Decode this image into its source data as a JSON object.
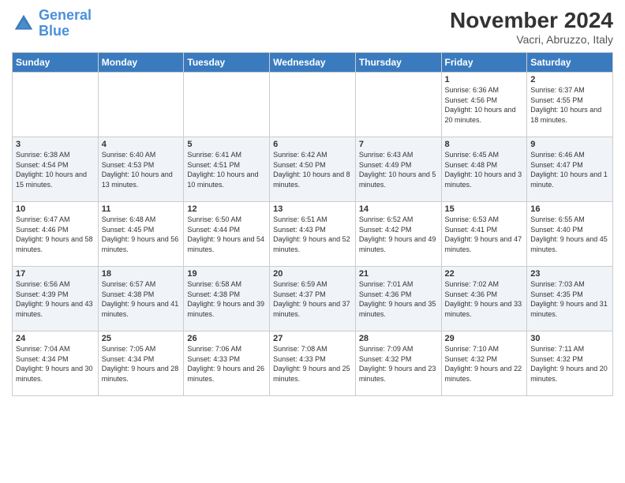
{
  "header": {
    "logo_line1": "General",
    "logo_line2": "Blue",
    "month": "November 2024",
    "location": "Vacri, Abruzzo, Italy"
  },
  "weekdays": [
    "Sunday",
    "Monday",
    "Tuesday",
    "Wednesday",
    "Thursday",
    "Friday",
    "Saturday"
  ],
  "weeks": [
    [
      {
        "day": "",
        "info": ""
      },
      {
        "day": "",
        "info": ""
      },
      {
        "day": "",
        "info": ""
      },
      {
        "day": "",
        "info": ""
      },
      {
        "day": "",
        "info": ""
      },
      {
        "day": "1",
        "info": "Sunrise: 6:36 AM\nSunset: 4:56 PM\nDaylight: 10 hours and 20 minutes."
      },
      {
        "day": "2",
        "info": "Sunrise: 6:37 AM\nSunset: 4:55 PM\nDaylight: 10 hours and 18 minutes."
      }
    ],
    [
      {
        "day": "3",
        "info": "Sunrise: 6:38 AM\nSunset: 4:54 PM\nDaylight: 10 hours and 15 minutes."
      },
      {
        "day": "4",
        "info": "Sunrise: 6:40 AM\nSunset: 4:53 PM\nDaylight: 10 hours and 13 minutes."
      },
      {
        "day": "5",
        "info": "Sunrise: 6:41 AM\nSunset: 4:51 PM\nDaylight: 10 hours and 10 minutes."
      },
      {
        "day": "6",
        "info": "Sunrise: 6:42 AM\nSunset: 4:50 PM\nDaylight: 10 hours and 8 minutes."
      },
      {
        "day": "7",
        "info": "Sunrise: 6:43 AM\nSunset: 4:49 PM\nDaylight: 10 hours and 5 minutes."
      },
      {
        "day": "8",
        "info": "Sunrise: 6:45 AM\nSunset: 4:48 PM\nDaylight: 10 hours and 3 minutes."
      },
      {
        "day": "9",
        "info": "Sunrise: 6:46 AM\nSunset: 4:47 PM\nDaylight: 10 hours and 1 minute."
      }
    ],
    [
      {
        "day": "10",
        "info": "Sunrise: 6:47 AM\nSunset: 4:46 PM\nDaylight: 9 hours and 58 minutes."
      },
      {
        "day": "11",
        "info": "Sunrise: 6:48 AM\nSunset: 4:45 PM\nDaylight: 9 hours and 56 minutes."
      },
      {
        "day": "12",
        "info": "Sunrise: 6:50 AM\nSunset: 4:44 PM\nDaylight: 9 hours and 54 minutes."
      },
      {
        "day": "13",
        "info": "Sunrise: 6:51 AM\nSunset: 4:43 PM\nDaylight: 9 hours and 52 minutes."
      },
      {
        "day": "14",
        "info": "Sunrise: 6:52 AM\nSunset: 4:42 PM\nDaylight: 9 hours and 49 minutes."
      },
      {
        "day": "15",
        "info": "Sunrise: 6:53 AM\nSunset: 4:41 PM\nDaylight: 9 hours and 47 minutes."
      },
      {
        "day": "16",
        "info": "Sunrise: 6:55 AM\nSunset: 4:40 PM\nDaylight: 9 hours and 45 minutes."
      }
    ],
    [
      {
        "day": "17",
        "info": "Sunrise: 6:56 AM\nSunset: 4:39 PM\nDaylight: 9 hours and 43 minutes."
      },
      {
        "day": "18",
        "info": "Sunrise: 6:57 AM\nSunset: 4:38 PM\nDaylight: 9 hours and 41 minutes."
      },
      {
        "day": "19",
        "info": "Sunrise: 6:58 AM\nSunset: 4:38 PM\nDaylight: 9 hours and 39 minutes."
      },
      {
        "day": "20",
        "info": "Sunrise: 6:59 AM\nSunset: 4:37 PM\nDaylight: 9 hours and 37 minutes."
      },
      {
        "day": "21",
        "info": "Sunrise: 7:01 AM\nSunset: 4:36 PM\nDaylight: 9 hours and 35 minutes."
      },
      {
        "day": "22",
        "info": "Sunrise: 7:02 AM\nSunset: 4:36 PM\nDaylight: 9 hours and 33 minutes."
      },
      {
        "day": "23",
        "info": "Sunrise: 7:03 AM\nSunset: 4:35 PM\nDaylight: 9 hours and 31 minutes."
      }
    ],
    [
      {
        "day": "24",
        "info": "Sunrise: 7:04 AM\nSunset: 4:34 PM\nDaylight: 9 hours and 30 minutes."
      },
      {
        "day": "25",
        "info": "Sunrise: 7:05 AM\nSunset: 4:34 PM\nDaylight: 9 hours and 28 minutes."
      },
      {
        "day": "26",
        "info": "Sunrise: 7:06 AM\nSunset: 4:33 PM\nDaylight: 9 hours and 26 minutes."
      },
      {
        "day": "27",
        "info": "Sunrise: 7:08 AM\nSunset: 4:33 PM\nDaylight: 9 hours and 25 minutes."
      },
      {
        "day": "28",
        "info": "Sunrise: 7:09 AM\nSunset: 4:32 PM\nDaylight: 9 hours and 23 minutes."
      },
      {
        "day": "29",
        "info": "Sunrise: 7:10 AM\nSunset: 4:32 PM\nDaylight: 9 hours and 22 minutes."
      },
      {
        "day": "30",
        "info": "Sunrise: 7:11 AM\nSunset: 4:32 PM\nDaylight: 9 hours and 20 minutes."
      }
    ]
  ]
}
